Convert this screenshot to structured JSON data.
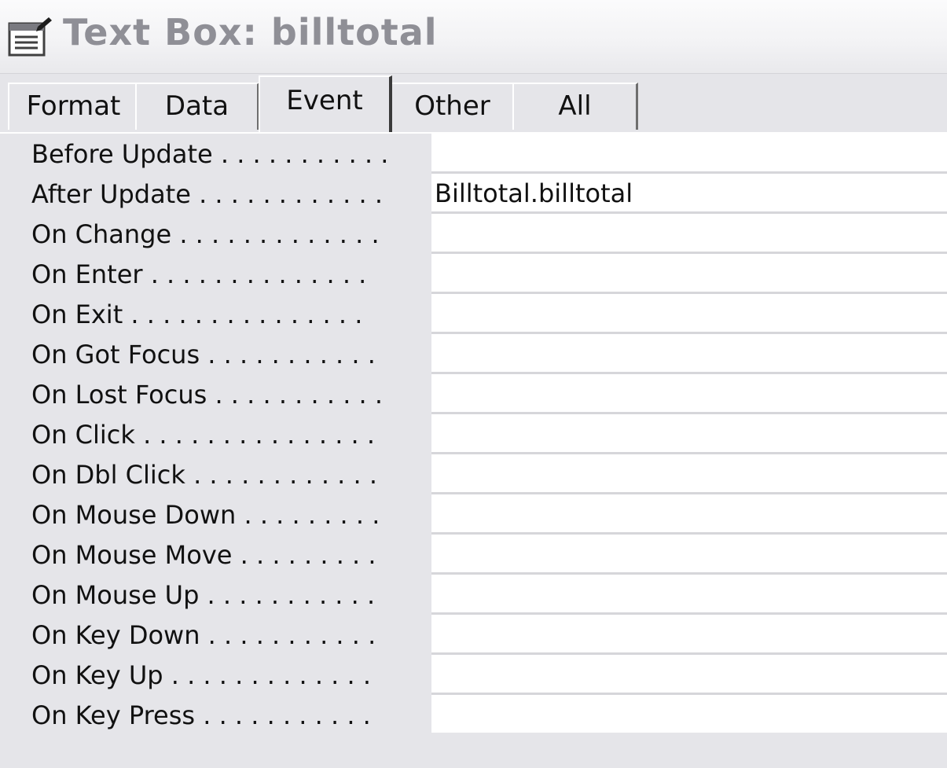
{
  "window": {
    "title": "Text Box: billtotal",
    "icon": "properties-icon"
  },
  "tabs": [
    {
      "label": "Format",
      "active": false
    },
    {
      "label": "Data",
      "active": false
    },
    {
      "label": "Event",
      "active": true
    },
    {
      "label": "Other",
      "active": false
    },
    {
      "label": "All",
      "active": false
    }
  ],
  "properties": [
    {
      "label": "Before Update . . . . . . . . . . .",
      "value": ""
    },
    {
      "label": "After Update . . . . . . . . . . . .",
      "value": "Billtotal.billtotal"
    },
    {
      "label": "On Change . . . . . . . . . . . . .",
      "value": ""
    },
    {
      "label": "On Enter . . . . . . . . . . . . . .",
      "value": ""
    },
    {
      "label": "On Exit . . . . . . . . . . . . . . .",
      "value": ""
    },
    {
      "label": "On Got Focus . . . . . . . . . . .",
      "value": ""
    },
    {
      "label": "On Lost Focus . . . . . . . . . . .",
      "value": ""
    },
    {
      "label": "On Click . . . . . . . . . . . . . . .",
      "value": ""
    },
    {
      "label": "On Dbl Click . . . . . . . . . . . .",
      "value": ""
    },
    {
      "label": "On Mouse Down . . . . . . . . .",
      "value": ""
    },
    {
      "label": "On Mouse Move . . . . . . . . .",
      "value": ""
    },
    {
      "label": "On Mouse Up . . . . . . . . . . .",
      "value": ""
    },
    {
      "label": "On Key Down . . . . . . . . . . .",
      "value": ""
    },
    {
      "label": "On Key Up . . . . . . . . . . . . .",
      "value": ""
    },
    {
      "label": "On Key Press . . . . . . . . . . .",
      "value": ""
    }
  ],
  "colors": {
    "background": "#e5e5e9",
    "value_field": "#ffffff",
    "title_text": "#8f8f96"
  }
}
